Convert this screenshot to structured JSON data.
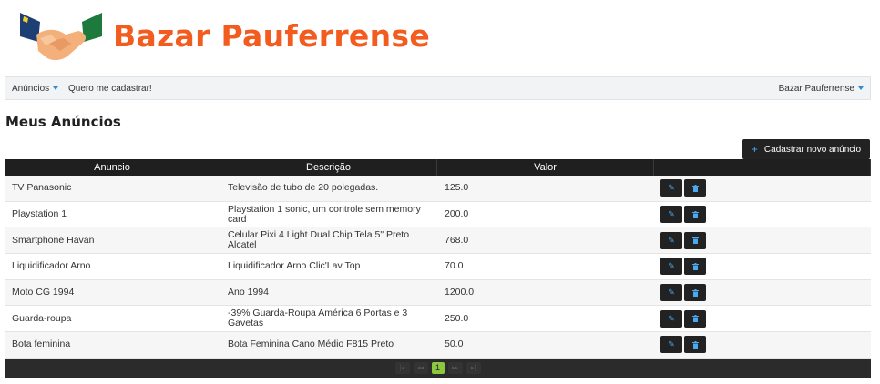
{
  "header": {
    "brand": "Bazar Pauferrense"
  },
  "navbar": {
    "left": [
      {
        "label": "Anúncios",
        "dropdown": true
      },
      {
        "label": "Quero me cadastrar!",
        "dropdown": false
      }
    ],
    "right": {
      "label": "Bazar Pauferrense",
      "dropdown": true
    }
  },
  "page": {
    "title": "Meus Anúncios",
    "new_button": "Cadastrar novo anúncio"
  },
  "table": {
    "columns": [
      "Anuncio",
      "Descrição",
      "Valor",
      ""
    ],
    "rows": [
      {
        "anuncio": "TV Panasonic",
        "descricao": "Televisão de tubo de 20 polegadas.",
        "valor": "125.0"
      },
      {
        "anuncio": "Playstation 1",
        "descricao": "Playstation 1 sonic, um controle sem memory card",
        "valor": "200.0"
      },
      {
        "anuncio": "Smartphone Havan",
        "descricao": "Celular Pixi 4 Light Dual Chip Tela 5\" Preto Alcatel",
        "valor": "768.0"
      },
      {
        "anuncio": "Liquidificador Arno",
        "descricao": "Liquidificador Arno Clic'Lav Top",
        "valor": "70.0"
      },
      {
        "anuncio": "Moto CG 1994",
        "descricao": "Ano 1994",
        "valor": "1200.0"
      },
      {
        "anuncio": "Guarda-roupa",
        "descricao": "-39% Guarda-Roupa América 6 Portas e 3 Gavetas",
        "valor": "250.0"
      },
      {
        "anuncio": "Bota feminina",
        "descricao": "Bota Feminina Cano Médio F815 Preto",
        "valor": "50.0"
      }
    ],
    "row_actions": {
      "edit_icon": "pencil-icon",
      "delete_icon": "trash-icon"
    }
  },
  "pager": {
    "first": "|◂",
    "prev": "◂◂",
    "current": "1",
    "next": "▸▸",
    "last": "▸|"
  },
  "colors": {
    "brand": "#f25c1f",
    "accent": "#2e8bd8",
    "dark": "#222222",
    "current_page": "#8dc63f"
  }
}
